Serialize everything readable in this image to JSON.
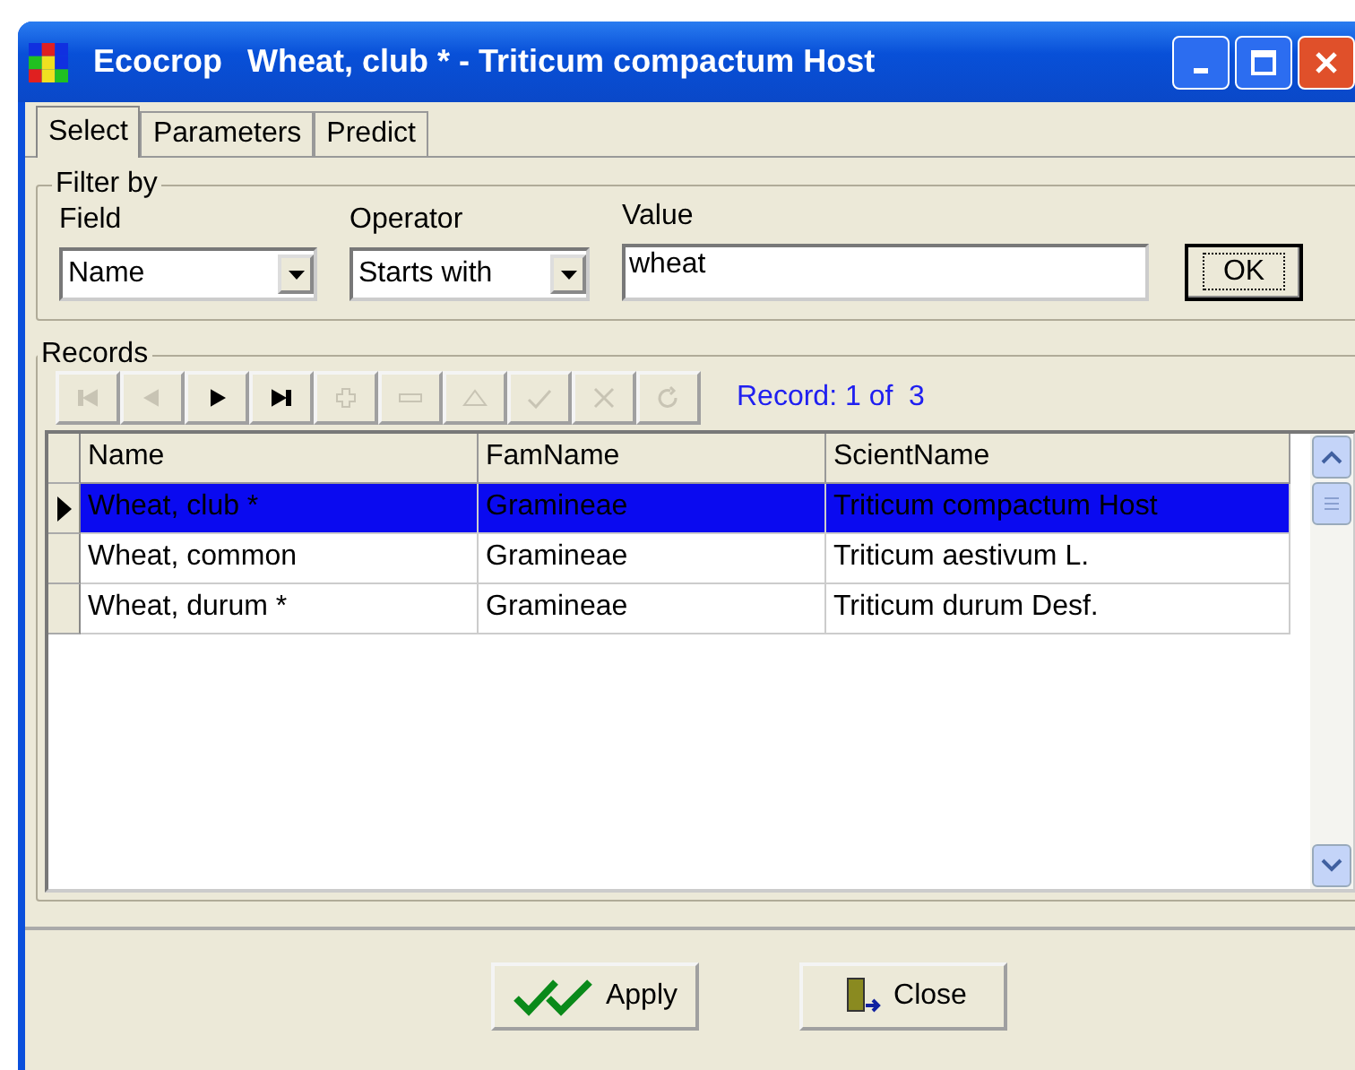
{
  "window": {
    "app": "Ecocrop",
    "title": "Wheat, club * - Triticum compactum Host"
  },
  "tabs": [
    {
      "label": "Select",
      "selected": true
    },
    {
      "label": "Parameters",
      "selected": false
    },
    {
      "label": "Predict",
      "selected": false
    }
  ],
  "filter": {
    "legend": "Filter by",
    "field_label": "Field",
    "field_value": "Name",
    "operator_label": "Operator",
    "operator_value": "Starts with",
    "value_label": "Value",
    "value": "wheat",
    "ok": "OK"
  },
  "records": {
    "legend": "Records",
    "nav": [
      {
        "kind": "first",
        "disabled": true
      },
      {
        "kind": "prior",
        "disabled": true
      },
      {
        "kind": "next",
        "disabled": false
      },
      {
        "kind": "last",
        "disabled": false
      },
      {
        "kind": "insert",
        "disabled": true
      },
      {
        "kind": "delete",
        "disabled": true
      },
      {
        "kind": "edit",
        "disabled": true
      },
      {
        "kind": "post",
        "disabled": true
      },
      {
        "kind": "cancel",
        "disabled": true
      },
      {
        "kind": "refresh",
        "disabled": true
      }
    ],
    "status": "Record: 1 of  3",
    "columns": [
      "Name",
      "FamName",
      "ScientName"
    ],
    "rows": [
      {
        "cells": [
          "Wheat, club *",
          "Gramineae",
          "Triticum compactum Host"
        ],
        "selected": true
      },
      {
        "cells": [
          "Wheat, common",
          "Gramineae",
          "Triticum aestivum L."
        ],
        "selected": false
      },
      {
        "cells": [
          "Wheat, durum *",
          "Gramineae",
          "Triticum durum Desf."
        ],
        "selected": false
      }
    ]
  },
  "buttons": [
    {
      "kind": "apply",
      "label": "Apply"
    },
    {
      "kind": "close",
      "label": "Close"
    }
  ]
}
